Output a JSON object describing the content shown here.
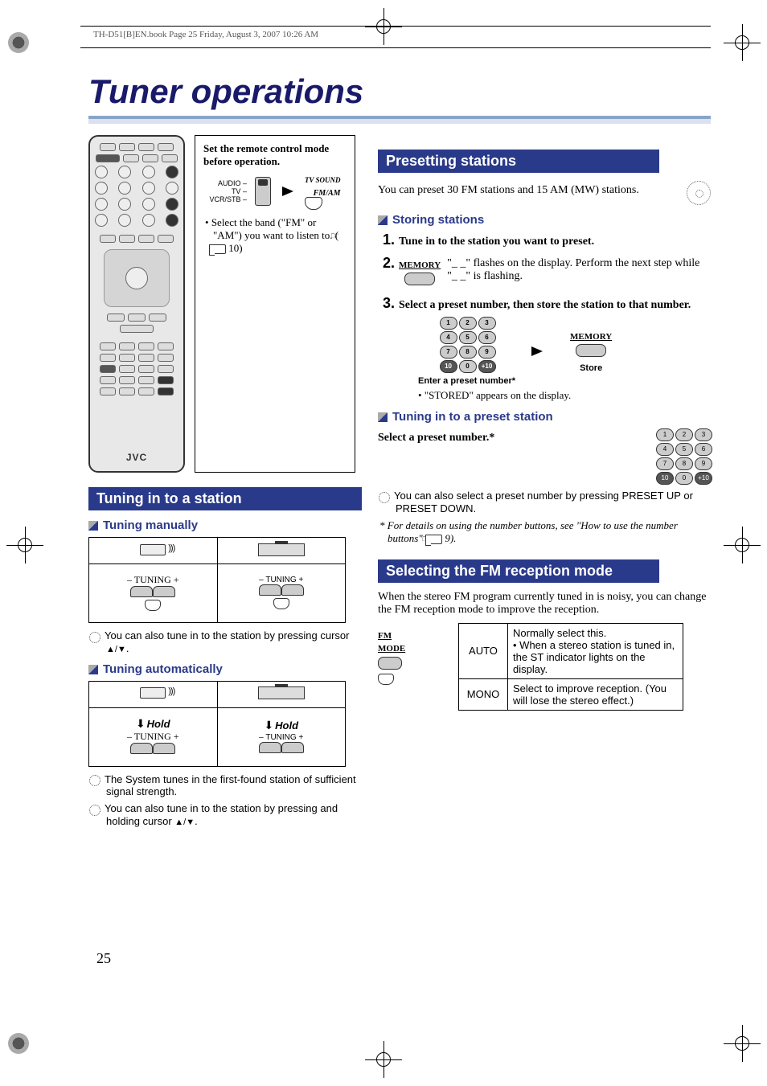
{
  "header_path": "TH-D51[B]EN.book  Page 25  Friday, August 3, 2007  10:26 AM",
  "title": "Tuner operations",
  "remote_brand": "JVC",
  "callout": {
    "line1": "Set the remote control mode before operation.",
    "mode_labels": "AUDIO\nTV\nVCR/STB",
    "tvsound": "TV SOUND",
    "fmam": "FM/AM",
    "bullet": "Select the band (\"FM\" or \"AM\") you want to listen to. (",
    "bullet_ref": " 10)"
  },
  "left": {
    "section": "Tuning in to a station",
    "h_manual": "Tuning manually",
    "h_auto": "Tuning automatically",
    "tuning_label_remote": "TUNING",
    "tuning_label_unit": "TUNING",
    "hold": "Hold",
    "note1_a": "You can also tune in to the station by pressing cursor ",
    "note1_b": ".",
    "arrows": "▲/▼",
    "note_auto1": "The System tunes in the first-found station of sufficient signal strength.",
    "note_auto2_a": "You can also tune in to the station by pressing and holding cursor ",
    "note_auto2_b": "."
  },
  "right": {
    "h_preset": "Presetting stations",
    "p_preset": "You can preset 30 FM stations and 15 AM (MW) stations.",
    "h_storing": "Storing stations",
    "step1": "Tune in to the station you want to preset.",
    "step2": "\"_ _\" flashes on the display. Perform the next step while \"_ _\" is flashing.",
    "step3": "Select a preset number, then store the station to that number.",
    "memory_label": "MEMORY",
    "enter_caption": "Enter a preset number*",
    "store_caption": "Store",
    "bullet_stored": "\"STORED\" appears on the display.",
    "h_tune_preset": "Tuning in to a preset station",
    "select_preset": "Select a preset number.*",
    "note_preset": "You can also select a preset number by pressing PRESET UP or PRESET DOWN.",
    "footnote_a": "For details on using the number buttons, see \"How to use the number buttons\" (",
    "footnote_b": " 9).",
    "h_fm": "Selecting the FM reception mode",
    "p_fm": "When the stereo FM program currently tuned in is noisy, you can change the FM reception mode to improve the reception.",
    "fmmode": "FM MODE",
    "fm_table": {
      "auto_label": "AUTO",
      "auto_text_a": "Normally select this.",
      "auto_text_b": "When a stereo station is tuned in, the ST indicator lights on the display.",
      "mono_label": "MONO",
      "mono_text": "Select to improve reception. (You will lose the stereo effect.)"
    }
  },
  "page_number": "25"
}
